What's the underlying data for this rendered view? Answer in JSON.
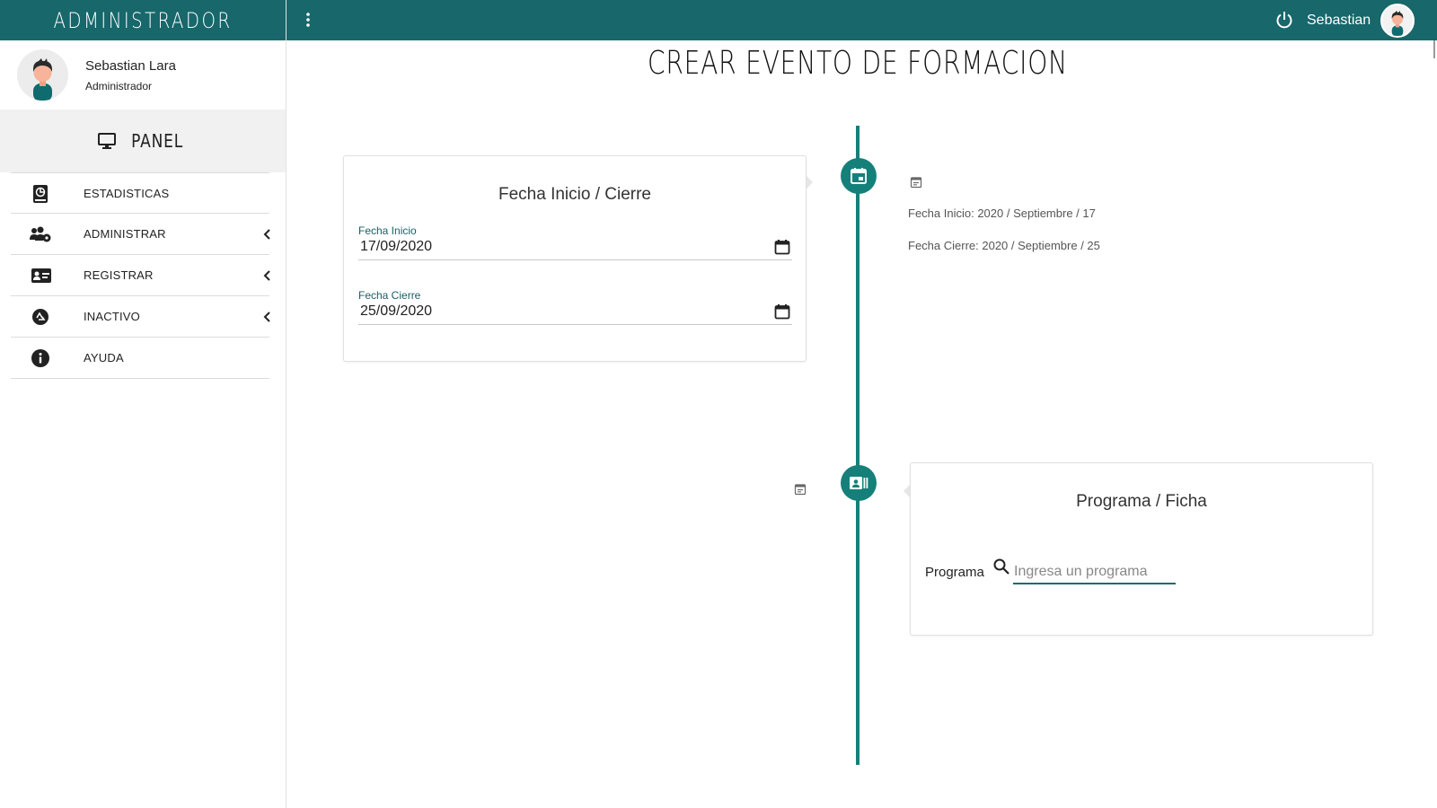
{
  "sidebar": {
    "brand": "ADMINISTRADOR",
    "user": {
      "name": "Sebastian Lara",
      "role": "Administrador"
    },
    "panel_label": "PANEL",
    "items": [
      {
        "label": "ESTADISTICAS",
        "icon": "stats-book-icon",
        "has_submenu": false
      },
      {
        "label": "ADMINISTRAR",
        "icon": "users-cog-icon",
        "has_submenu": true
      },
      {
        "label": "REGISTRAR",
        "icon": "id-card-icon",
        "has_submenu": true
      },
      {
        "label": "INACTIVO",
        "icon": "recycle-icon",
        "has_submenu": true
      },
      {
        "label": "AYUDA",
        "icon": "info-icon",
        "has_submenu": false
      }
    ]
  },
  "topbar": {
    "user_name": "Sebastian",
    "icons": [
      "kebab-menu-icon",
      "power-icon",
      "avatar"
    ]
  },
  "main": {
    "title": "CREAR EVENTO DE FORMACION",
    "dates_card": {
      "title": "Fecha Inicio / Cierre",
      "start_label": "Fecha Inicio",
      "start_value": "17/09/2020",
      "end_label": "Fecha Cierre",
      "end_value": "25/09/2020"
    },
    "dates_summary": {
      "start_text": "Fecha Inicio: 2020 / Septiembre / 17",
      "end_text": "Fecha Cierre: 2020 / Septiembre / 25"
    },
    "program_card": {
      "title": "Programa / Ficha",
      "program_label": "Programa",
      "program_placeholder": "Ingresa un programa",
      "program_value": ""
    }
  },
  "colors": {
    "header": "#17676b",
    "accent": "#15807a",
    "panel_bg": "#f1f1f1"
  }
}
